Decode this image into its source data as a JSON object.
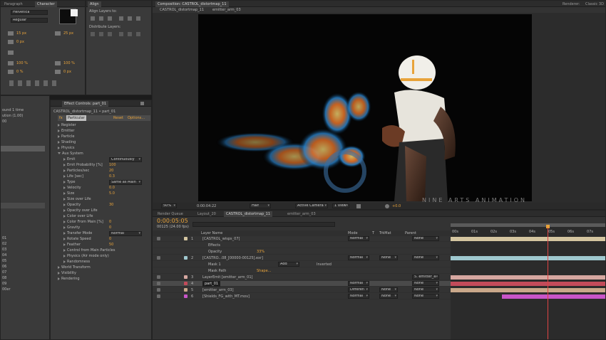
{
  "top_left_panel": {
    "tabs": [
      "Paragraph",
      "Character"
    ],
    "fields": [
      "Helvetica",
      "Regular",
      "15 px",
      "25 px",
      "100 %",
      "100 %",
      "0 %",
      "0 px",
      "0 px"
    ]
  },
  "align_panel": {
    "tab": "Align",
    "composition_tab": "Composition",
    "align_layers_label": "Align Layers to:",
    "distribute_label": "Distribute Layers:"
  },
  "composition_viewer": {
    "tab_label": "Composition: CASTROL_distortmap_11",
    "breadcrumb": [
      "CASTROL_distortmap_11",
      "emitter_arm_03"
    ],
    "workspace": "Renderer:",
    "workspace_value": "Classic 3D",
    "footer": {
      "zoom": "50%",
      "timecode": "0:00:04:22",
      "resolution": "Half",
      "camera": "Active Camera",
      "views": "1 View",
      "exposure": "+0.0"
    }
  },
  "watermark": {
    "subtitle": "NINE ARTS ANIMATION"
  },
  "project_panel": {
    "items": [
      "ound 1 time",
      "ution (1.00)",
      "00",
      "",
      "01",
      "02",
      "03",
      "04",
      "05",
      "06",
      "07",
      "08",
      "09",
      "00er"
    ]
  },
  "effect_controls": {
    "tab_label": "Effect Controls: part_01",
    "layer_path": "CASTROL_distortmap_11 • part_01",
    "effect_name": "Particular",
    "reset_label": "Reset",
    "options_label": "Options...",
    "rows": [
      {
        "label": "Register",
        "value": ""
      },
      {
        "label": "Emitter",
        "value": ""
      },
      {
        "label": "Particle",
        "value": ""
      },
      {
        "label": "Shading",
        "value": ""
      },
      {
        "label": "Physics",
        "value": ""
      },
      {
        "label": "Aux System",
        "value": ""
      },
      {
        "label": "Emit",
        "value": "Continuously"
      },
      {
        "label": "Emit Probability [%]",
        "value": "100"
      },
      {
        "label": "Particles/sec",
        "value": "20"
      },
      {
        "label": "Life [sec]",
        "value": "0.3"
      },
      {
        "label": "Type",
        "value": "Same as Main"
      },
      {
        "label": "Velocity",
        "value": "0.0"
      },
      {
        "label": "Size",
        "value": "5.0"
      },
      {
        "label": "Size over Life",
        "value": ""
      },
      {
        "label": "Opacity",
        "value": "30"
      },
      {
        "label": "Opacity over Life",
        "value": ""
      },
      {
        "label": "Color over Life",
        "value": ""
      },
      {
        "label": "Color From Main [%]",
        "value": "0"
      },
      {
        "label": "Gravity",
        "value": "0"
      },
      {
        "label": "Transfer Mode",
        "value": "Normal"
      },
      {
        "label": "Rotate Speed",
        "value": "0"
      },
      {
        "label": "Feather",
        "value": "50"
      },
      {
        "label": "Control from Main Particles",
        "value": ""
      },
      {
        "label": "Physics (Air mode only)",
        "value": ""
      },
      {
        "label": "Randomness",
        "value": ""
      },
      {
        "label": "World Transform",
        "value": ""
      },
      {
        "label": "Visibility",
        "value": ""
      },
      {
        "label": "Rendering",
        "value": ""
      }
    ]
  },
  "timeline": {
    "tabs": [
      "Render Queue",
      "Layout_20",
      "CASTROL_distortmap_11",
      "emitter_arm_03"
    ],
    "timecode": "0:00:05:05",
    "frame_info": "00125 (24.00 fps)",
    "search_placeholder": "",
    "column_headers": {
      "layer_name": "Layer Name",
      "mode": "Mode",
      "t": "T",
      "trkmat": "TrkMat",
      "parent": "Parent"
    },
    "ruler": [
      "00s",
      "01s",
      "02s",
      "03s",
      "04s",
      "05s",
      "06s",
      "07s"
    ],
    "layers": [
      {
        "num": "1",
        "name": "[CASTROL_wisps_07]",
        "mode": "Normal",
        "trkmat": "",
        "parent": "None",
        "color": "#d4c5a0"
      },
      {
        "num": "",
        "name": "Effects",
        "mode": "",
        "trkmat": "",
        "parent": "",
        "color": ""
      },
      {
        "num": "",
        "name": "Opacity",
        "mode": "",
        "trkmat": "",
        "parent": "",
        "value": "33%",
        "color": ""
      },
      {
        "num": "2",
        "name": "[CASTRO...08_[00000-00125].exr]",
        "mode": "Normal",
        "trkmat": "None",
        "parent": "None",
        "color": "#9fc8cf"
      },
      {
        "num": "",
        "name": "Mask 1",
        "mode": "Add",
        "trkmat": "Inverted",
        "parent": "",
        "color": ""
      },
      {
        "num": "",
        "name": "Mask Path",
        "mode": "",
        "trkmat": "",
        "parent": "",
        "value": "Shape...",
        "color": ""
      },
      {
        "num": "3",
        "name": "LayerEmit [emitter_arm_01]",
        "mode": "",
        "trkmat": "",
        "parent": "5. emitter_a",
        "color": "#d6a7a0"
      },
      {
        "num": "4",
        "name": "part_01",
        "mode": "Normal",
        "trkmat": "",
        "parent": "None",
        "color": "#c24b5a"
      },
      {
        "num": "5",
        "name": "[emitter_arm_03]",
        "mode": "Differen",
        "trkmat": "None",
        "parent": "None",
        "color": "#c9a88a"
      },
      {
        "num": "6",
        "name": "[Shields_FG_with_MT.mov]",
        "mode": "Normal",
        "trkmat": "None",
        "parent": "None",
        "color": "#c855c8"
      }
    ]
  },
  "colors": {
    "accent": "#e8a33a",
    "playhead": "#e04444",
    "selected_layer": "#c24b5a"
  }
}
